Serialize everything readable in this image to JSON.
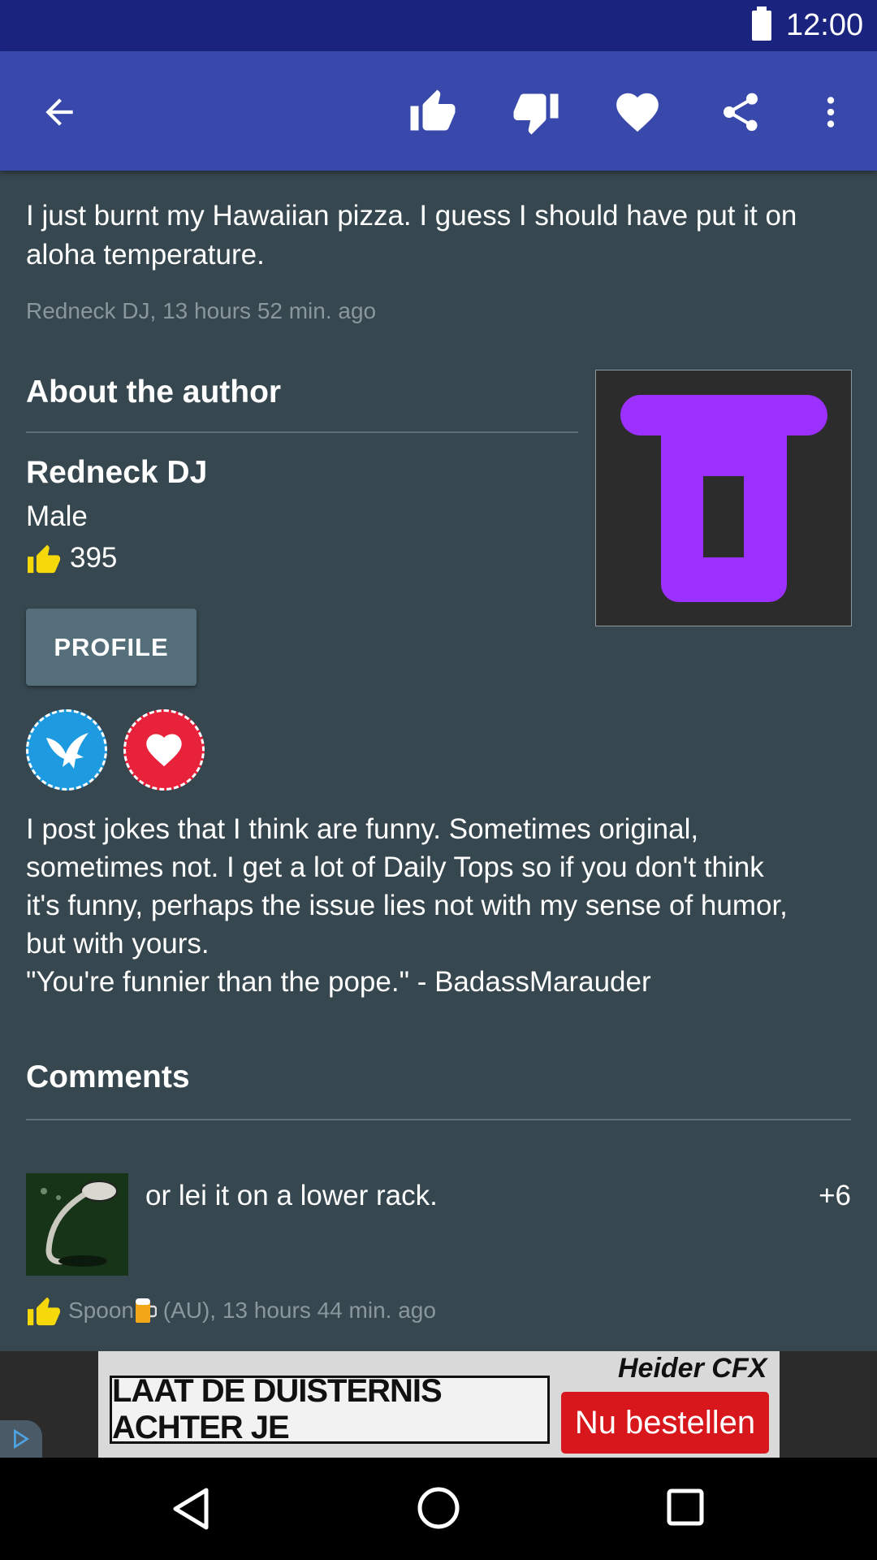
{
  "status_bar": {
    "time": "12:00",
    "battery_icon": "battery-full-icon"
  },
  "toolbar": {
    "back_icon": "arrow-back-icon",
    "actions": [
      "thumbs-up-icon",
      "thumbs-down-icon",
      "heart-icon",
      "share-icon",
      "more-vert-icon"
    ]
  },
  "joke": {
    "text": "I just burnt my Hawaiian pizza. I guess I should have put it on aloha temperature.",
    "meta": "Redneck DJ, 13 hours 52 min. ago"
  },
  "author": {
    "heading": "About the author",
    "name": "Redneck DJ",
    "gender": "Male",
    "likes": "395",
    "profile_button": "PROFILE",
    "avatar_color": "#9b30ff",
    "badges": [
      "eagle-badge-icon",
      "heart-badge-icon"
    ],
    "bio_lines": [
      "I post jokes that I think are funny. Sometimes original,",
      "sometimes not. I get a lot of Daily Tops so if you don't think",
      "it's funny, perhaps the issue lies not with my sense of humor,",
      "but with yours.",
      "\"You're funnier than the pope.\" - BadassMarauder"
    ]
  },
  "comments": {
    "heading": "Comments",
    "items": [
      {
        "text": "or lei it on a lower rack.",
        "score": "+6",
        "author": "Spoon",
        "meta_suffix": " (AU), 13 hours 44 min. ago"
      }
    ]
  },
  "ad": {
    "tagline": "LAAT DE DUISTERNIS ACHTER JE",
    "brand": "Heider CFX",
    "cta": "Nu bestellen"
  },
  "colors": {
    "status_bar": "#1a237e",
    "app_bar": "#3949ab",
    "background": "#37474f",
    "thumb_yellow": "#f5d90a"
  }
}
